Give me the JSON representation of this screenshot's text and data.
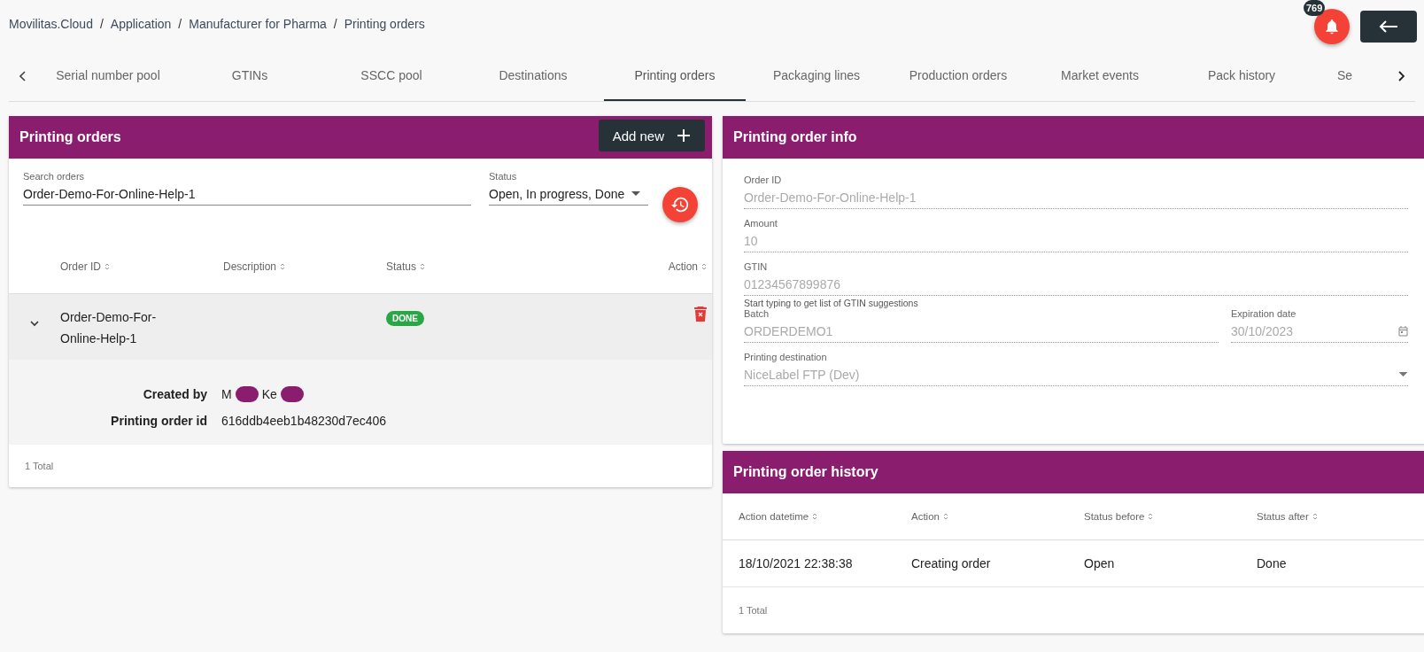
{
  "breadcrumb": [
    "Movilitas.Cloud",
    "Application",
    "Manufacturer for Pharma",
    "Printing orders"
  ],
  "breadcrumb_separator": "/",
  "notifications": {
    "count": "769"
  },
  "tabs": [
    {
      "label": "Serial number pool",
      "selected": false
    },
    {
      "label": "GTINs",
      "selected": false
    },
    {
      "label": "SSCC pool",
      "selected": false
    },
    {
      "label": "Destinations",
      "selected": false
    },
    {
      "label": "Printing orders",
      "selected": true
    },
    {
      "label": "Packaging lines",
      "selected": false
    },
    {
      "label": "Production orders",
      "selected": false
    },
    {
      "label": "Market events",
      "selected": false
    },
    {
      "label": "Pack history",
      "selected": false
    },
    {
      "label": "Se",
      "selected": false
    }
  ],
  "orders_panel": {
    "title": "Printing orders",
    "add_button": "Add new",
    "search": {
      "label": "Search orders",
      "value": "Order-Demo-For-Online-Help-1"
    },
    "status_filter": {
      "label": "Status",
      "value": "Open, In progress, Done"
    },
    "columns": [
      "Order ID",
      "Description",
      "Status",
      "Action"
    ],
    "rows": [
      {
        "order_id": "Order-Demo-For-Online-Help-1",
        "description": "",
        "status": "DONE",
        "color": "#28a745",
        "expanded": true,
        "details": [
          {
            "label": "Created by",
            "value_parts": [
              "M",
              "Ke"
            ]
          },
          {
            "label": "Printing order id",
            "value_parts": [
              "616ddb4eeb1b48230d7ec406"
            ]
          }
        ]
      }
    ],
    "total": "1 Total"
  },
  "info_panel": {
    "title": "Printing order info",
    "disabled": true,
    "fields": [
      {
        "label": "Order ID",
        "value": "Order-Demo-For-Online-Help-1"
      },
      {
        "label": "Amount",
        "value": "10"
      },
      {
        "label": "GTIN",
        "value": "01234567899876",
        "hint": "Start typing to get list of GTIN suggestions"
      }
    ],
    "batch": {
      "label": "Batch",
      "value": "ORDERDEMO1"
    },
    "expiration": {
      "label": "Expiration date",
      "value": "30/10/2023"
    },
    "destination": {
      "label": "Printing destination",
      "value": "NiceLabel FTP (Dev)"
    }
  },
  "history_panel": {
    "title": "Printing order history",
    "columns": [
      "Action datetime",
      "Action",
      "Status before",
      "Status after"
    ],
    "rows": [
      [
        "18/10/2021 22:38:38",
        "Creating order",
        "Open",
        "Done"
      ]
    ],
    "total": "1 Total"
  }
}
